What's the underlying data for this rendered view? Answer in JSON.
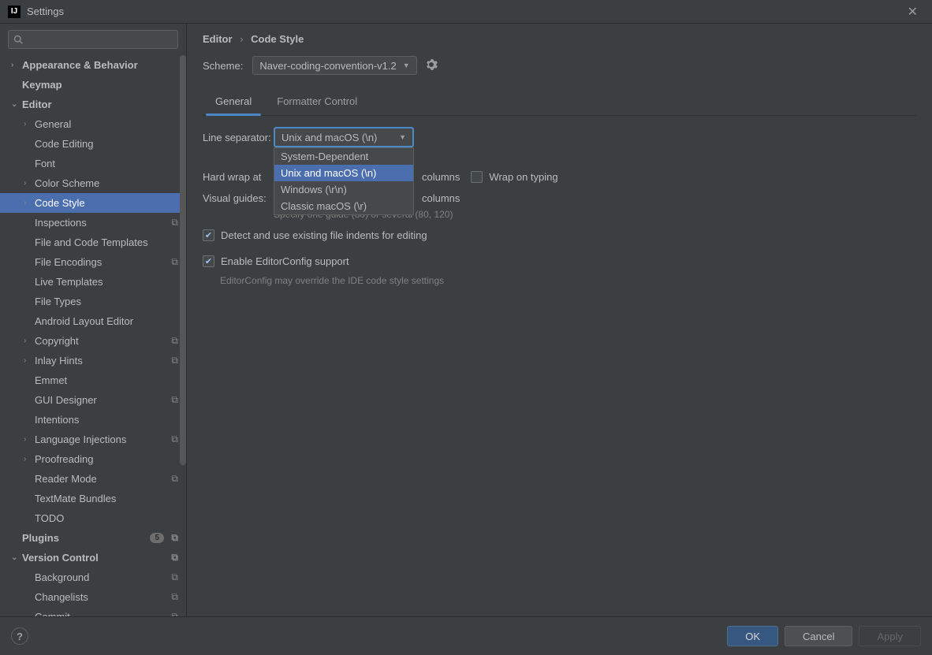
{
  "window": {
    "title": "Settings"
  },
  "sidebar": {
    "search_placeholder": "",
    "items": [
      {
        "label": "Appearance & Behavior",
        "bold": true,
        "arrow": ">",
        "level": 0
      },
      {
        "label": "Keymap",
        "bold": true,
        "level": 0
      },
      {
        "label": "Editor",
        "bold": true,
        "arrow": "v",
        "level": 0
      },
      {
        "label": "General",
        "arrow": ">",
        "level": 1
      },
      {
        "label": "Code Editing",
        "level": 1
      },
      {
        "label": "Font",
        "level": 1
      },
      {
        "label": "Color Scheme",
        "arrow": ">",
        "level": 1
      },
      {
        "label": "Code Style",
        "arrow": ">",
        "level": 1,
        "selected": true
      },
      {
        "label": "Inspections",
        "level": 1,
        "overlay": true
      },
      {
        "label": "File and Code Templates",
        "level": 1
      },
      {
        "label": "File Encodings",
        "level": 1,
        "overlay": true
      },
      {
        "label": "Live Templates",
        "level": 1
      },
      {
        "label": "File Types",
        "level": 1
      },
      {
        "label": "Android Layout Editor",
        "level": 1
      },
      {
        "label": "Copyright",
        "arrow": ">",
        "level": 1,
        "overlay": true
      },
      {
        "label": "Inlay Hints",
        "arrow": ">",
        "level": 1,
        "overlay": true
      },
      {
        "label": "Emmet",
        "level": 1
      },
      {
        "label": "GUI Designer",
        "level": 1,
        "overlay": true
      },
      {
        "label": "Intentions",
        "level": 1
      },
      {
        "label": "Language Injections",
        "arrow": ">",
        "level": 1,
        "overlay": true
      },
      {
        "label": "Proofreading",
        "arrow": ">",
        "level": 1
      },
      {
        "label": "Reader Mode",
        "level": 1,
        "overlay": true
      },
      {
        "label": "TextMate Bundles",
        "level": 1
      },
      {
        "label": "TODO",
        "level": 1
      },
      {
        "label": "Plugins",
        "bold": true,
        "level": 0,
        "badge": "5",
        "overlay": true
      },
      {
        "label": "Version Control",
        "bold": true,
        "arrow": "v",
        "level": 0,
        "overlay": true
      },
      {
        "label": "Background",
        "level": 1,
        "overlay": true
      },
      {
        "label": "Changelists",
        "level": 1,
        "overlay": true
      },
      {
        "label": "Commit",
        "level": 1,
        "overlay": true
      }
    ]
  },
  "breadcrumb": {
    "a": "Editor",
    "b": "Code Style"
  },
  "scheme": {
    "label": "Scheme:",
    "value": "Naver-coding-convention-v1.2"
  },
  "tabs": {
    "general": "General",
    "formatter": "Formatter Control"
  },
  "form": {
    "line_separator_label": "Line separator:",
    "line_separator_value": "Unix and macOS (\\n)",
    "options": [
      "System-Dependent",
      "Unix and macOS (\\n)",
      "Windows (\\r\\n)",
      "Classic macOS (\\r)"
    ],
    "hard_wrap_label": "Hard wrap at",
    "columns": "columns",
    "wrap_on_typing": "Wrap on typing",
    "visual_guides_label": "Visual guides:",
    "guides_hint": "Specify one guide (80) or several (80, 120)",
    "detect_indents": "Detect and use existing file indents for editing",
    "editorconfig": "Enable EditorConfig support",
    "editorconfig_hint": "EditorConfig may override the IDE code style settings"
  },
  "footer": {
    "ok": "OK",
    "cancel": "Cancel",
    "apply": "Apply"
  }
}
